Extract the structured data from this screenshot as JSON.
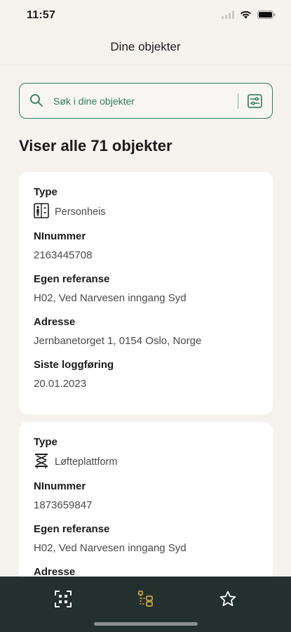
{
  "status_bar": {
    "time": "11:57"
  },
  "header": {
    "title": "Dine objekter"
  },
  "search": {
    "placeholder": "Søk i dine objekter"
  },
  "result_heading": "Viser alle 71 objekter",
  "labels": {
    "type": "Type",
    "ninummer": "NInummer",
    "egen_referanse": "Egen referanse",
    "adresse": "Adresse",
    "siste_loggforing": "Siste loggføring"
  },
  "objects": [
    {
      "type": "Personheis",
      "type_icon": "elevator-icon",
      "ninummer": "2163445708",
      "egen_referanse": "H02, Ved Narvesen inngang Syd",
      "adresse": "Jernbanetorget 1, 0154 Oslo, Norge",
      "siste_loggforing": "20.01.2023"
    },
    {
      "type": "Løfteplattform",
      "type_icon": "lift-platform-icon",
      "ninummer": "1873659847",
      "egen_referanse": "H02, Ved Narvesen inngang Syd"
    }
  ],
  "tab_bar": {
    "tabs": [
      {
        "name": "scan",
        "icon": "scan-icon",
        "active": false
      },
      {
        "name": "objects",
        "icon": "objects-list-icon",
        "active": true
      },
      {
        "name": "favorites",
        "icon": "star-icon",
        "active": false
      }
    ]
  },
  "colors": {
    "background": "#f6f3ef",
    "accent_green": "#2f7a5c",
    "tab_bar": "#23302d",
    "active_tab": "#c9a24a",
    "card": "#ffffff"
  }
}
